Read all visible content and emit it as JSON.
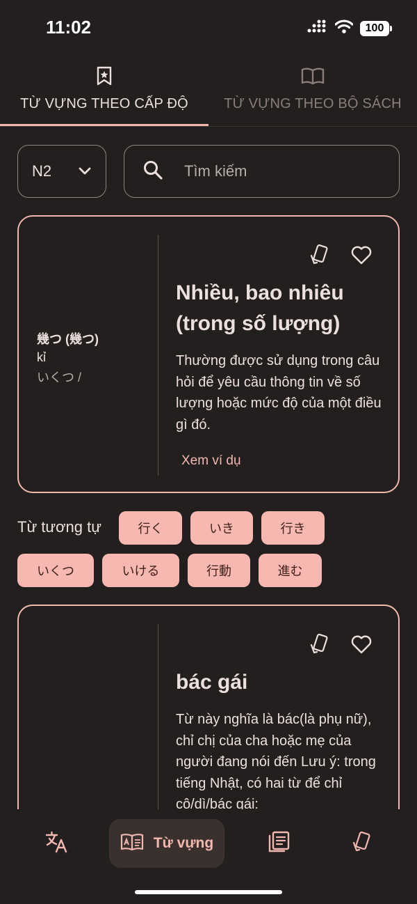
{
  "status_bar": {
    "time": "11:02",
    "battery": "100"
  },
  "tabs": [
    {
      "label": "TỪ VỰNG THEO CẤP ĐỘ",
      "icon": "bookmark-star-icon",
      "active": true
    },
    {
      "label": "TỪ VỰNG THEO BỘ SÁCH",
      "icon": "open-book-icon",
      "active": false
    }
  ],
  "filters": {
    "level": "N2",
    "search_placeholder": "Tìm kiếm"
  },
  "cards": [
    {
      "kanji": "幾つ (幾つ)",
      "romaji": "kỉ",
      "kana": "いくつ /",
      "title": "Nhiều, bao nhiêu (trong số lượng)",
      "description": "Thường được sử dụng trong câu hỏi để yêu cầu thông tin về số lượng hoặc mức độ của một điều gì đó.",
      "example_link": "Xem ví dụ"
    },
    {
      "kanji": "",
      "romaji": "",
      "kana": "",
      "title": "bác gái",
      "description": "Từ này nghĩa là bác(là phụ nữ), chỉ chị của cha hoặc mẹ của người đang nói đến Lưu ý: trong tiếng Nhật, có hai từ để chỉ cô/dì/bác gái:",
      "example_link": ""
    }
  ],
  "similar": {
    "label": "Từ tương tự",
    "chips": [
      "行く",
      "いき",
      "行き",
      "いくつ",
      "いける",
      "行動",
      "進む"
    ]
  },
  "bottom_nav": [
    {
      "label": "",
      "icon": "translate-icon",
      "active": false
    },
    {
      "label": "Từ vựng",
      "icon": "vocabulary-book-icon",
      "active": true
    },
    {
      "label": "",
      "icon": "article-list-icon",
      "active": false
    },
    {
      "label": "",
      "icon": "flashcards-icon",
      "active": false
    }
  ],
  "colors": {
    "background": "#231f1f",
    "accent": "#f2b8b0",
    "chip": "#f6b8b0",
    "text": "#ece0de"
  }
}
